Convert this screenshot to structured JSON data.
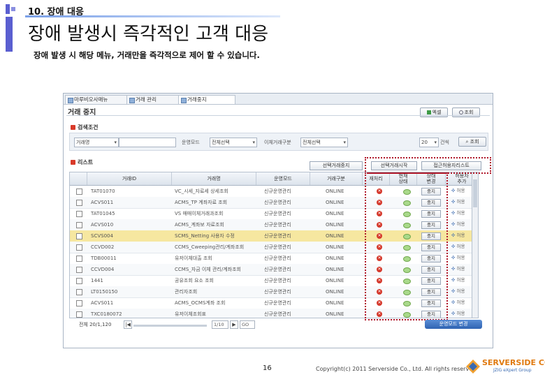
{
  "slide": {
    "section": "10. 장애 대응",
    "title": "장애 발생시 즉각적인 고객 대응",
    "subtitle": "장애 발생 시 해당 메뉴, 거래만을 즉각적으로 제어 할 수 있습니다.",
    "page_number": "16",
    "copyright": "Copyright(c) 2011 Serverside Co., Ltd. All rights reserved",
    "logo_name": "SERVERSIDE CO.",
    "logo_tag": "JZIG eXpert Group",
    "accent_color": "#5a5fd0"
  },
  "app": {
    "tabs": [
      "마루비오사매뉴",
      "거래 관리",
      "거래중지"
    ],
    "page_title": "거래 중지",
    "excel_label": "엑셀",
    "refresh_label": "조회",
    "search_section": "검색조건",
    "list_section": "리스트",
    "filters": {
      "type_select": "거래명",
      "label1": "운영모드",
      "select1": "전체선택",
      "label2": "이체거래구분",
      "select2": "전체선택",
      "page_size": "20",
      "label3": "건씩",
      "search_btn": "조회"
    },
    "actions": {
      "btn1": "선택거래중지",
      "btn2": "선택거래시작",
      "btn3": "접근허용자리스트"
    },
    "columns": [
      "",
      "거래ID",
      "거래명",
      "운영모드",
      "거래구분",
      "재처리",
      "현재\n상태",
      "상태\n변경",
      "허용자\n추가"
    ],
    "rows": [
      {
        "id": "TAT01070",
        "name": "VC_시세_자료세 상세조회",
        "mode": "신규운영관리",
        "type": "ONLINE",
        "action": "중지"
      },
      {
        "id": "ACVS011",
        "name": "ACMS_TP 계좌자료 조회",
        "mode": "신규운영관리",
        "type": "ONLINE",
        "action": "중지"
      },
      {
        "id": "TAT01045",
        "name": "VS 매매이체거래과조회",
        "mode": "신규운영관리",
        "type": "ONLINE",
        "action": "중지"
      },
      {
        "id": "ACVS010",
        "name": "ACMS_계좌보 자료조회",
        "mode": "신규운영관리",
        "type": "ONLINE",
        "action": "중지"
      },
      {
        "id": "SCVS004",
        "name": "SCMS_Netting 사용자 수정",
        "mode": "신규운영관리",
        "type": "ONLINE",
        "action": "중지"
      },
      {
        "id": "CCVD002",
        "name": "CCMS_Cweeping관리/계좌조회",
        "mode": "신규운영관리",
        "type": "ONLINE",
        "action": "중지"
      },
      {
        "id": "TDB00011",
        "name": "유저이체대출 조회",
        "mode": "신규운영관리",
        "type": "ONLINE",
        "action": "중지"
      },
      {
        "id": "CCVD004",
        "name": "CCMS_자금 이체 관리/계좌조회",
        "mode": "신규운영관리",
        "type": "ONLINE",
        "action": "중지"
      },
      {
        "id": "1441",
        "name": "공유조회 요소 조회",
        "mode": "신규운영관리",
        "type": "ONLINE",
        "action": "중지"
      },
      {
        "id": "LT0150150",
        "name": "관리자조회",
        "mode": "신규운영관리",
        "type": "ONLINE",
        "action": "중지"
      },
      {
        "id": "ACVS011",
        "name": "ACMS_OCMS계좌 조회",
        "mode": "신규운영관리",
        "type": "ONLINE",
        "action": "중지"
      },
      {
        "id": "TXC0180072",
        "name": "유저이체조회표",
        "mode": "신규운영관리",
        "type": "ONLINE",
        "action": "중지"
      }
    ],
    "add_label": "허용",
    "pager_label": "전체 20/1,120",
    "page_input": "1/10",
    "page_go": "GO",
    "bottom_button": "운영모드 변경"
  }
}
